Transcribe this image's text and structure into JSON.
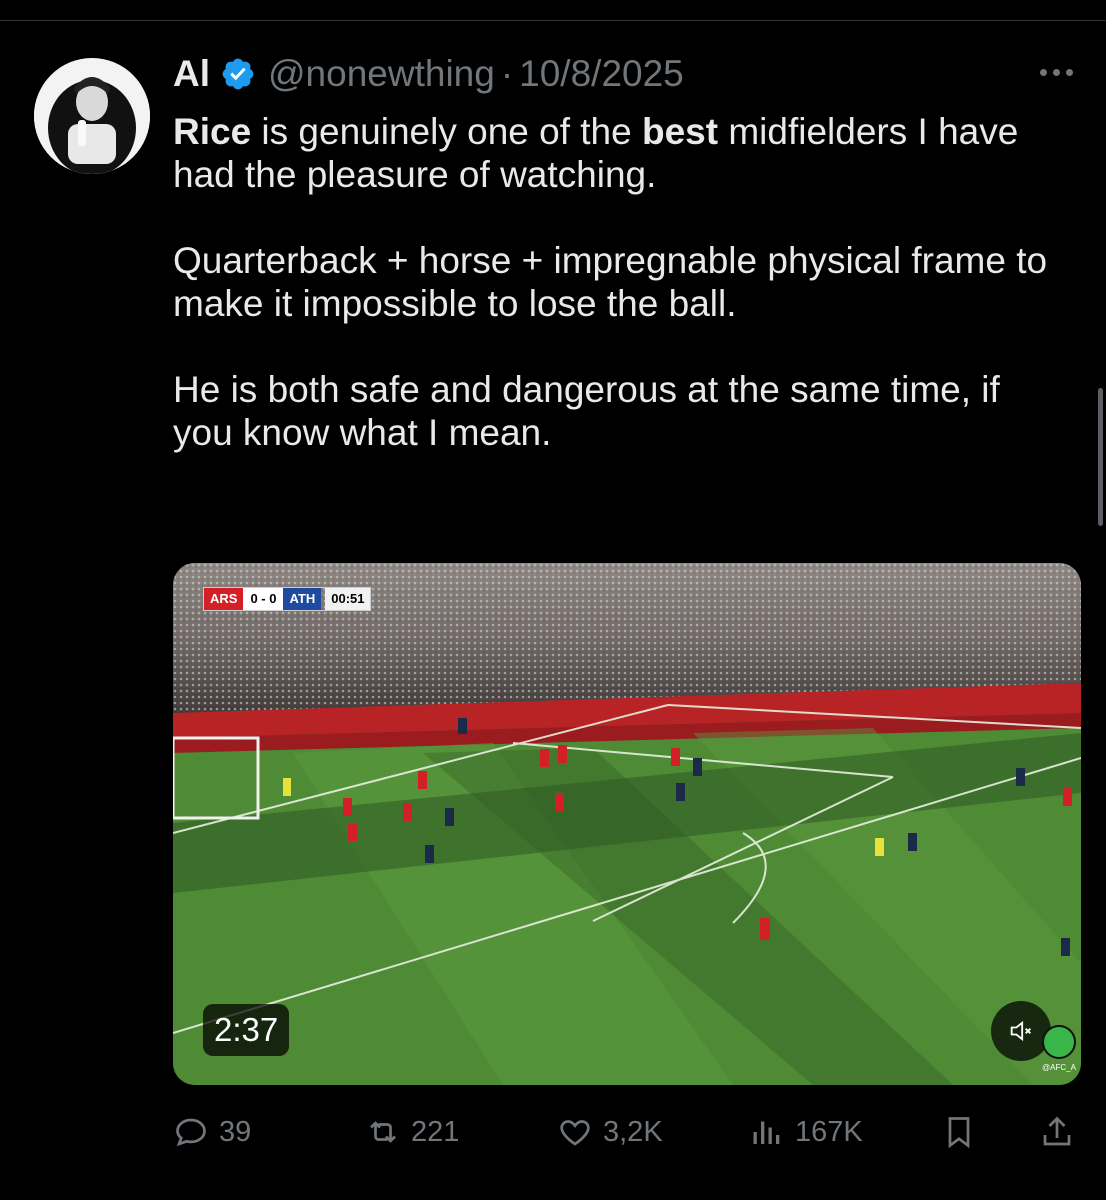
{
  "tweet": {
    "display_name": "Al",
    "handle": "@nonewthing",
    "separator": "·",
    "date": "10/8/2025",
    "paragraphs": {
      "p1_bold1": "Rice",
      "p1_mid1": " is genuinely one of the ",
      "p1_bold2": "best",
      "p1_rest": " midfielders I have had the pleasure of watching.",
      "p2": "Quarterback + horse + impregnable physical frame to make it impossible to lose the ball.",
      "p3": "He is both safe and dangerous at the same time, if you know what I mean."
    }
  },
  "media": {
    "scorebug": {
      "home": "ARS",
      "score": "0 - 0",
      "away": "ATH",
      "clock": "00:51"
    },
    "duration": "2:37",
    "watermark": "@AFC_A"
  },
  "actions": {
    "replies": "39",
    "reposts": "221",
    "likes": "3,2K",
    "views": "167K"
  },
  "icons": [
    "verified-icon",
    "more-icon",
    "reply-icon",
    "repost-icon",
    "like-icon",
    "views-icon",
    "bookmark-icon",
    "share-icon",
    "mute-icon"
  ],
  "colors": {
    "background": "#000000",
    "text": "#e7e9ea",
    "muted": "#71767b",
    "verified": "#1d9bf0"
  }
}
